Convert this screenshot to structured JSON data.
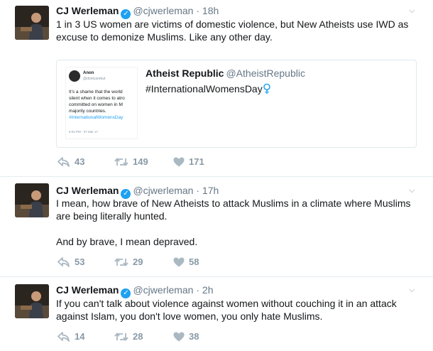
{
  "tweets": [
    {
      "name": "CJ Werleman",
      "handle": "@cjwerleman",
      "sep": "·",
      "time": "18h",
      "text": "1 in 3 US women are victims of domestic violence, but New Atheists use IWD as excuse to demonize Muslims. Like any other day.",
      "replies": "43",
      "retweets": "149",
      "likes": "171",
      "quote": {
        "name": "Atheist Republic",
        "handle": "@AtheistRepublic",
        "text": "#InternationalWomensDay",
        "emoji": "♀",
        "image": {
          "author": "Anon",
          "author_handle": "@dontcarebut",
          "lines": [
            "It's a shame that the world",
            "silent when it comes to atro",
            "committed on women in M",
            "majority countries."
          ],
          "hashtag": "#InternationalWomensDay",
          "time": "9:03 PM · 07 Mar 17"
        }
      }
    },
    {
      "name": "CJ Werleman",
      "handle": "@cjwerleman",
      "sep": "·",
      "time": "17h",
      "text": "I mean, how brave of New Atheists to attack Muslims in a climate where Muslims are being literally hunted.",
      "text2": "And by brave, I mean depraved.",
      "replies": "53",
      "retweets": "29",
      "likes": "58"
    },
    {
      "name": "CJ Werleman",
      "handle": "@cjwerleman",
      "sep": "·",
      "time": "2h",
      "text": "If you can't talk about violence against women without couching it in an attack against Islam, you don't love women, you only hate Muslims.",
      "replies": "14",
      "retweets": "28",
      "likes": "38"
    }
  ],
  "icons": {
    "verified": "verified-badge-icon",
    "menu": "chevron-down-icon",
    "reply": "reply-icon",
    "retweet": "retweet-icon",
    "like": "heart-icon"
  },
  "colors": {
    "accent": "#1da1f2",
    "muted": "#8899a6",
    "divider": "#e6ecf0"
  }
}
